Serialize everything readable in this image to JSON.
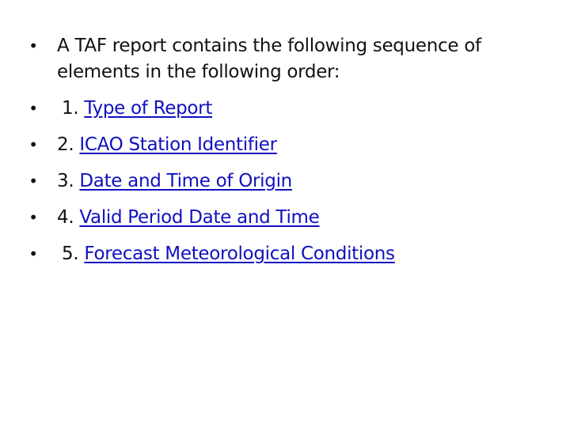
{
  "slide": {
    "intro": "A TAF report contains the following sequence of elements in the following order:",
    "items": [
      {
        "number": "1.",
        "label": "Type of Report",
        "indent": true
      },
      {
        "number": "2.",
        "label": "ICAO Station Identifier",
        "indent": false
      },
      {
        "number": "3.",
        "label": "Date and Time of Origin",
        "indent": false
      },
      {
        "number": "4.",
        "label": "Valid Period Date and Time",
        "indent": false
      },
      {
        "number": "5.",
        "label": "Forecast Meteorological Conditions",
        "indent": true
      }
    ],
    "bullet_glyph": "•",
    "colors": {
      "text": "#111111",
      "link": "#1010c0",
      "background": "#ffffff"
    }
  }
}
